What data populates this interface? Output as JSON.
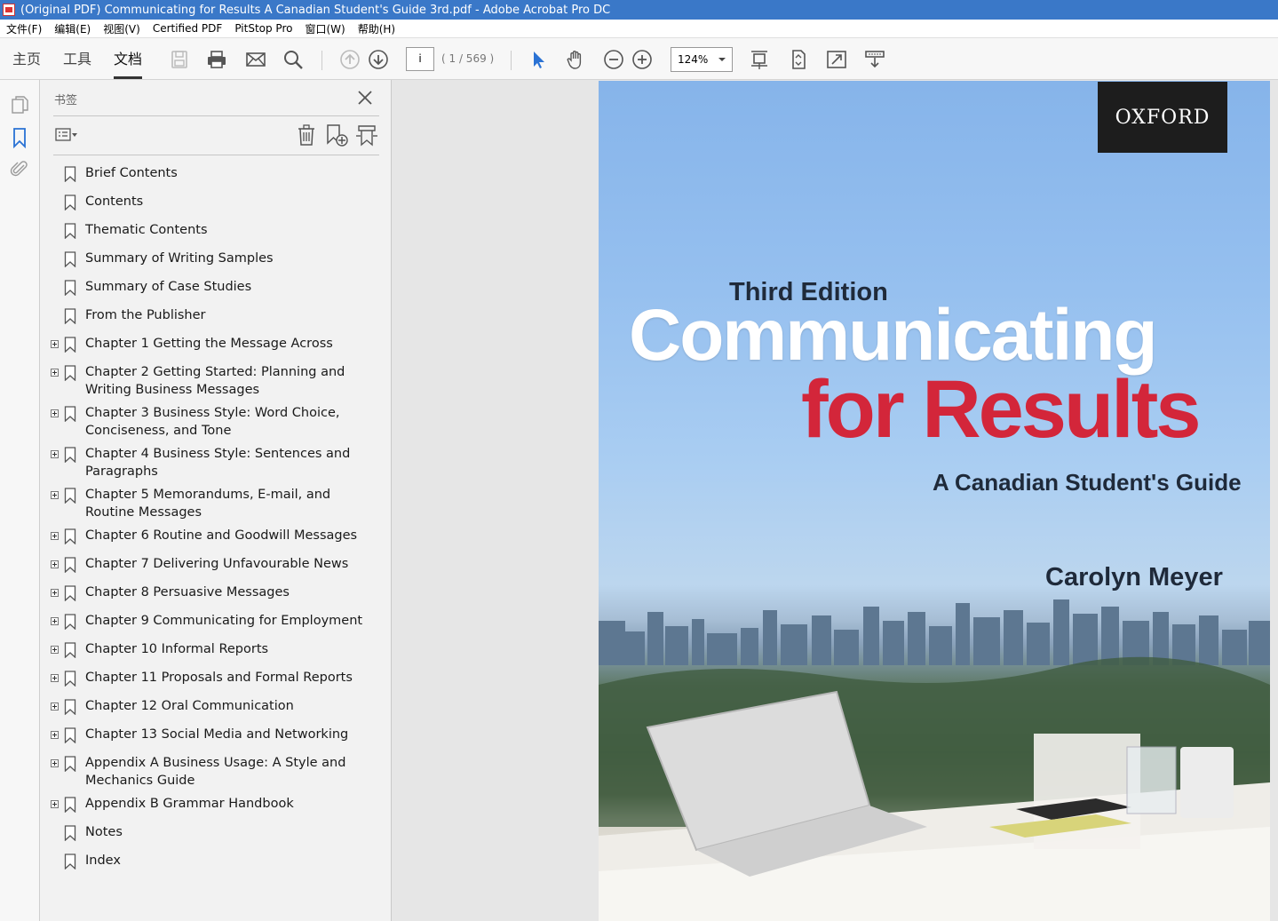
{
  "window": {
    "title": "(Original PDF) Communicating for Results A Canadian Student's Guide 3rd.pdf - Adobe Acrobat Pro DC"
  },
  "menu": [
    "文件(F)",
    "编辑(E)",
    "视图(V)",
    "Certified PDF",
    "PitStop Pro",
    "窗口(W)",
    "帮助(H)"
  ],
  "toolbar": {
    "tabs": [
      "主页",
      "工具",
      "文档"
    ],
    "active_tab": "文档",
    "page_input": "i",
    "page_count": "( 1 / 569 )",
    "zoom": "124%"
  },
  "panel": {
    "title": "书签",
    "bookmarks": [
      {
        "label": "Brief Contents",
        "expandable": false
      },
      {
        "label": "Contents",
        "expandable": false
      },
      {
        "label": "Thematic Contents",
        "expandable": false
      },
      {
        "label": "Summary of Writing Samples",
        "expandable": false
      },
      {
        "label": "Summary of Case Studies",
        "expandable": false
      },
      {
        "label": "From the Publisher",
        "expandable": false
      },
      {
        "label": "Chapter 1  Getting the Message Across",
        "expandable": true
      },
      {
        "label": "Chapter 2  Getting Started: Planning and Writing Business Messages",
        "expandable": true
      },
      {
        "label": "Chapter 3  Business Style: Word Choice, Conciseness, and Tone",
        "expandable": true
      },
      {
        "label": "Chapter 4  Business Style: Sentences and Paragraphs",
        "expandable": true
      },
      {
        "label": "Chapter 5  Memorandums, E-mail, and Routine Messages",
        "expandable": true
      },
      {
        "label": "Chapter 6  Routine and Goodwill Messages",
        "expandable": true
      },
      {
        "label": "Chapter 7  Delivering Unfavourable News",
        "expandable": true
      },
      {
        "label": "Chapter 8  Persuasive Messages",
        "expandable": true
      },
      {
        "label": "Chapter 9  Communicating for Employment",
        "expandable": true
      },
      {
        "label": "Chapter 10  Informal Reports",
        "expandable": true
      },
      {
        "label": "Chapter 11  Proposals and Formal Reports",
        "expandable": true
      },
      {
        "label": "Chapter 12  Oral Communication",
        "expandable": true
      },
      {
        "label": "Chapter 13  Social Media and Networking",
        "expandable": true
      },
      {
        "label": "Appendix A  Business Usage: A Style and Mechanics Guide",
        "expandable": true
      },
      {
        "label": "Appendix B  Grammar Handbook",
        "expandable": true
      },
      {
        "label": "Notes",
        "expandable": false
      },
      {
        "label": "Index",
        "expandable": false
      }
    ]
  },
  "cover": {
    "publisher": "OXFORD",
    "edition": "Third Edition",
    "title_line1": "Communicating",
    "title_line2": "for Results",
    "subtitle": "A Canadian Student's Guide",
    "author": "Carolyn Meyer"
  },
  "colors": {
    "titlebar": "#3a78c8",
    "title_red": "#d3263a",
    "accent_blue": "#2a72d4"
  }
}
